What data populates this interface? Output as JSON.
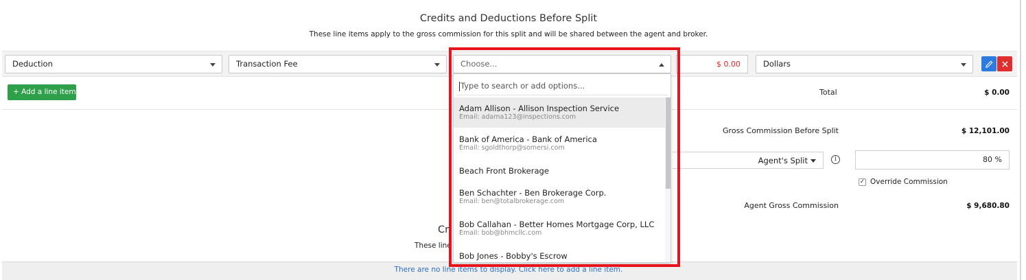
{
  "section": {
    "title": "Credits and Deductions Before Split",
    "subtitle": "These line items apply to the gross commission for this split and will be shared between the agent and broker."
  },
  "line_item": {
    "type_value": "Deduction",
    "category_value": "Transaction Fee",
    "payee_placeholder": "Choose...",
    "amount": "$ 0.00",
    "unit_value": "Dollars"
  },
  "add_button_label": "+ Add a line item",
  "totals": {
    "total_label": "Total",
    "total_value": "$ 0.00",
    "gross_before_label": "Gross Commission Before Split",
    "gross_before_value": "$ 12,101.00",
    "split_label": "Agent's Split",
    "split_value": "80 %",
    "override_label": "Override Commission",
    "agent_gross_label": "Agent Gross Commission",
    "agent_gross_value": "$ 9,680.80"
  },
  "lower_section": {
    "title_partial": "Cr",
    "subtitle_partial": "These line"
  },
  "empty_message": "There are no line items to display. Click here to add a line item.",
  "dropdown": {
    "search_placeholder": "Type to search or add options...",
    "options": [
      {
        "name": "Adam Allison - Allison Inspection Service",
        "email": "Email: adama123@inspections.com"
      },
      {
        "name": "Bank of America - Bank of America",
        "email": "Email: sgoldthorp@somersi.com"
      },
      {
        "name": "Beach Front Brokerage",
        "email": ""
      },
      {
        "name": "Ben Schachter - Ben Brokerage Corp.",
        "email": "Email: ben@totalbrokerage.com"
      },
      {
        "name": "Bob Callahan - Better Homes Mortgage Corp, LLC",
        "email": "Email: bob@bhmcllc.com"
      },
      {
        "name": "Bob Jones - Bobby's Escrow",
        "email": ""
      }
    ]
  },
  "icons": {
    "edit": "pencil-icon",
    "delete": "close-icon",
    "info": "info-icon",
    "check": "checkmark-icon"
  },
  "colors": {
    "accent_blue": "#2b7be0",
    "danger_red": "#e02d2d",
    "add_green": "#2ea04a",
    "amount_red": "#e02424",
    "highlight_red": "#e8141c",
    "link_blue": "#2a6fc1"
  }
}
